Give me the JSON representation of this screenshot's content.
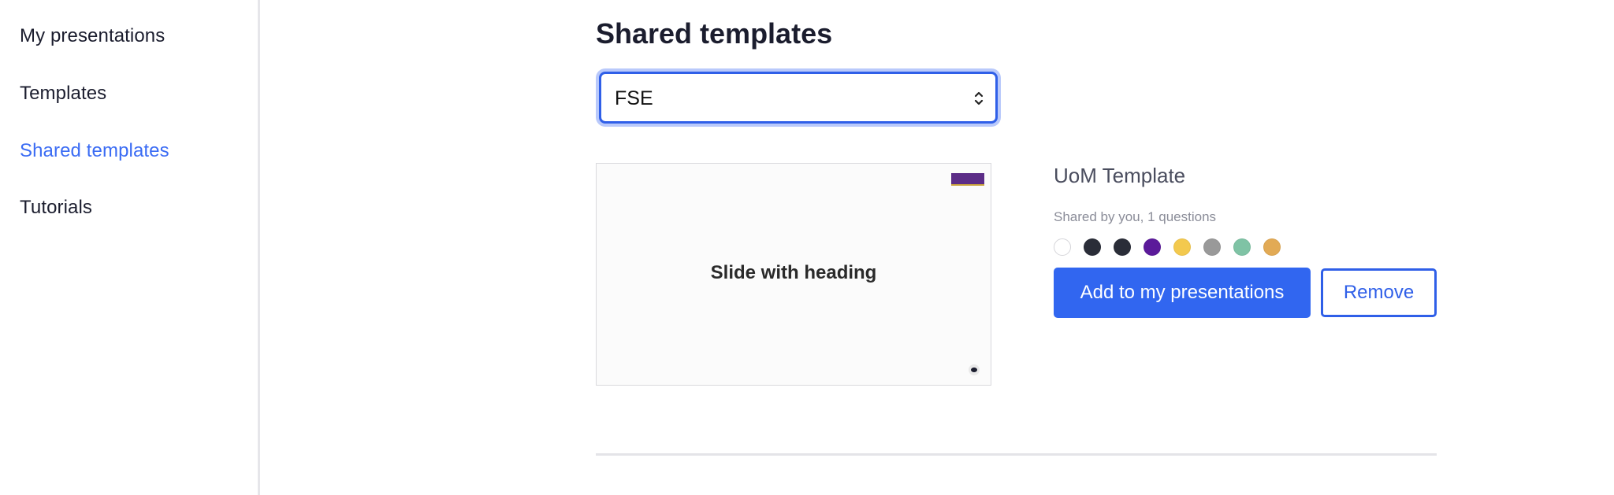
{
  "sidebar": {
    "items": [
      {
        "label": "My presentations",
        "active": false
      },
      {
        "label": "Templates",
        "active": false
      },
      {
        "label": "Shared templates",
        "active": true
      },
      {
        "label": "Tutorials",
        "active": false
      }
    ]
  },
  "main": {
    "title": "Shared templates",
    "select": {
      "value": "FSE",
      "icon": "up-down-chevron-icon"
    },
    "template": {
      "thumbnail_heading": "Slide with heading",
      "name": "UoM Template",
      "meta": "Shared by you, 1 questions",
      "colors": [
        "#ffffff",
        "#2a2d38",
        "#2a2d38",
        "#5b1a9a",
        "#f3c94e",
        "#999999",
        "#7fc3a5",
        "#e2aa55"
      ]
    },
    "actions": {
      "add_label": "Add to my presentations",
      "remove_label": "Remove"
    }
  },
  "colors": {
    "accent": "#3166f0",
    "text": "#1b1d2e"
  }
}
